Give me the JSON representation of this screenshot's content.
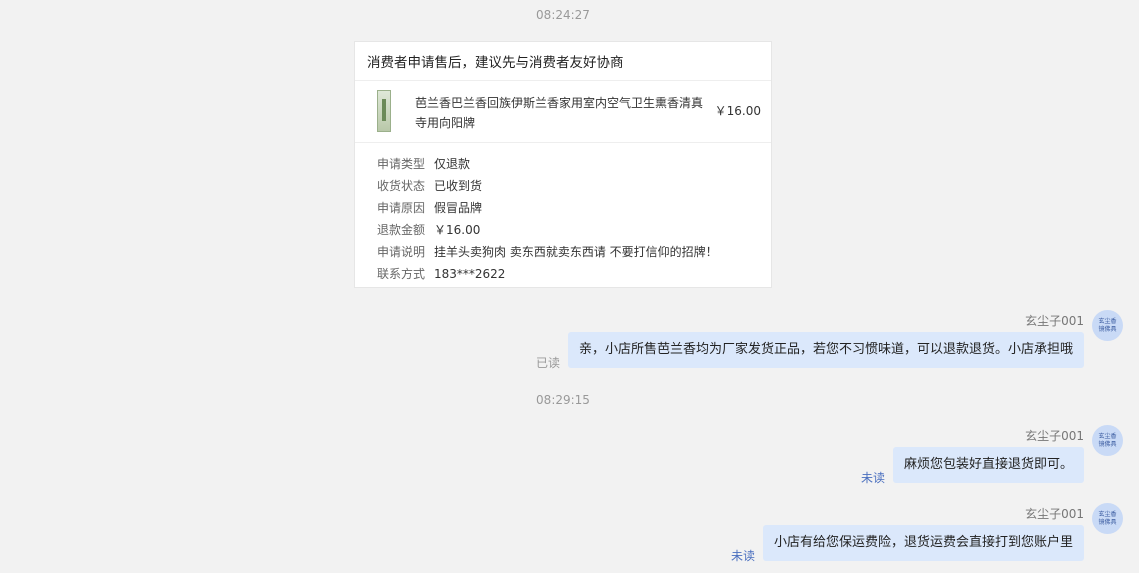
{
  "timestamps": [
    "08:24:27",
    "08:29:15"
  ],
  "card": {
    "title": "消费者申请售后，建议先与消费者友好协商",
    "product_name": "芭兰香巴兰香回族伊斯兰香家用室内空气卫生熏香清真寺用向阳牌",
    "product_price": "￥16.00",
    "fields": [
      {
        "key": "申请类型",
        "value": "仅退款"
      },
      {
        "key": "收货状态",
        "value": "已收到货"
      },
      {
        "key": "申请原因",
        "value": "假冒品牌"
      },
      {
        "key": "退款金额",
        "value": "￥16.00"
      },
      {
        "key": "申请说明",
        "value": "挂羊头卖狗肉 卖东西就卖东西请 不要打信仰的招牌！"
      },
      {
        "key": "联系方式",
        "value": "183***2622"
      }
    ]
  },
  "messages": [
    {
      "sender": "玄尘子001",
      "avatar_text": "玄尘香镜佛具",
      "text": "亲，小店所售芭兰香均为厂家发货正品，若您不习惯味道，可以退款退货。小店承担哦",
      "status": "已读"
    },
    {
      "sender": "玄尘子001",
      "avatar_text": "玄尘香镜佛具",
      "text": "麻烦您包装好直接退货即可。",
      "status": "未读"
    },
    {
      "sender": "玄尘子001",
      "avatar_text": "玄尘香镜佛具",
      "text": "小店有给您保运费险，退货运费会直接打到您账户里",
      "status": "未读"
    }
  ],
  "colors": {
    "bubble": "#dbe8fb",
    "unread": "#4a6fbf",
    "read": "#999999",
    "background": "#f2f2f2"
  }
}
